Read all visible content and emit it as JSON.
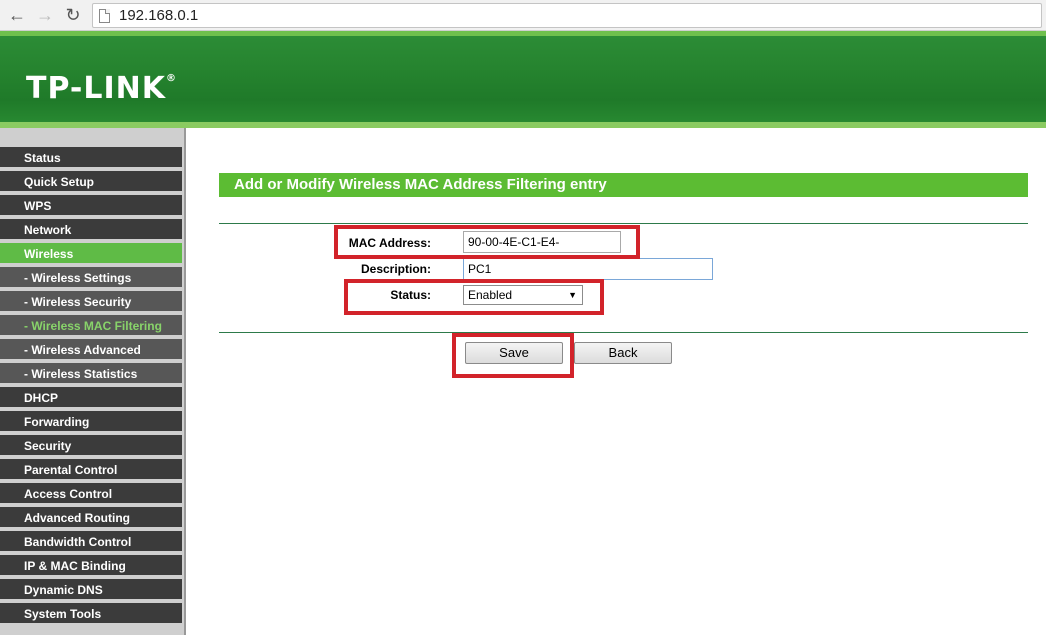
{
  "browser": {
    "url": "192.168.0.1",
    "back_icon": "arrow-left-icon",
    "forward_icon": "arrow-right-icon",
    "reload_icon": "reload-icon"
  },
  "header": {
    "logo": "TP-LINK",
    "logo_mark": "®"
  },
  "sidebar": {
    "items": [
      {
        "label": "Status",
        "type": "main"
      },
      {
        "label": "Quick Setup",
        "type": "main"
      },
      {
        "label": "WPS",
        "type": "main"
      },
      {
        "label": "Network",
        "type": "main"
      },
      {
        "label": "Wireless",
        "type": "main",
        "active": true
      },
      {
        "label": "- Wireless Settings",
        "type": "sub"
      },
      {
        "label": "- Wireless Security",
        "type": "sub"
      },
      {
        "label": "- Wireless MAC Filtering",
        "type": "sub",
        "current": true
      },
      {
        "label": "- Wireless Advanced",
        "type": "sub"
      },
      {
        "label": "- Wireless Statistics",
        "type": "sub"
      },
      {
        "label": "DHCP",
        "type": "main"
      },
      {
        "label": "Forwarding",
        "type": "main"
      },
      {
        "label": "Security",
        "type": "main"
      },
      {
        "label": "Parental Control",
        "type": "main"
      },
      {
        "label": "Access Control",
        "type": "main"
      },
      {
        "label": "Advanced Routing",
        "type": "main"
      },
      {
        "label": "Bandwidth Control",
        "type": "main"
      },
      {
        "label": "IP & MAC Binding",
        "type": "main"
      },
      {
        "label": "Dynamic DNS",
        "type": "main"
      },
      {
        "label": "System Tools",
        "type": "main"
      }
    ]
  },
  "form": {
    "title": "Add or Modify Wireless MAC Address Filtering entry",
    "mac_label": "MAC Address:",
    "mac_value": "90-00-4E-C1-E4-",
    "desc_label": "Description:",
    "desc_value": "PC1",
    "status_label": "Status:",
    "status_value": "Enabled",
    "save_label": "Save",
    "back_label": "Back"
  },
  "colors": {
    "brand_green": "#26842f",
    "title_green": "#5cbc33",
    "highlight_red": "#d2232a"
  }
}
